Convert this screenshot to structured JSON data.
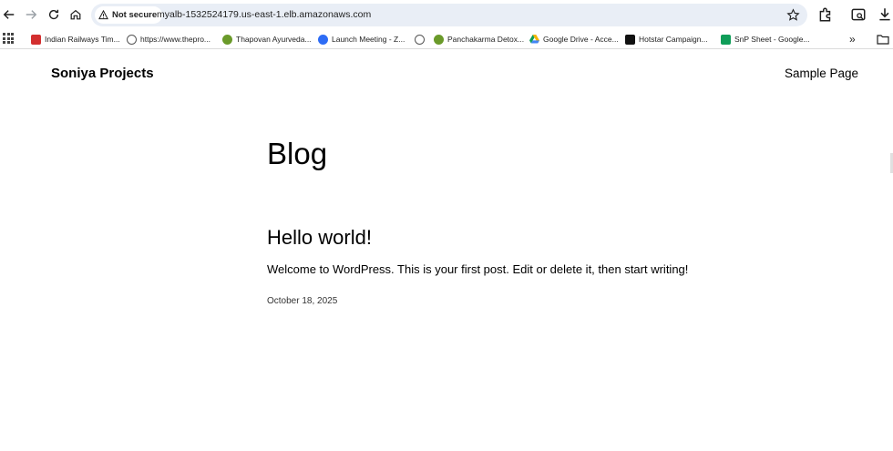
{
  "browser": {
    "security_label": "Not secure",
    "url": "myalb-1532524179.us-east-1.elb.amazonaws.com",
    "bookmarks": [
      {
        "label": "Indian Railways Tim...",
        "icon": "train-icon",
        "color": "#d32f2f"
      },
      {
        "label": "https://www.thepro...",
        "icon": "globe-icon",
        "color": "#555555"
      },
      {
        "label": "Thapovan Ayurveda...",
        "icon": "leaf-icon",
        "color": "#6a9a2a"
      },
      {
        "label": "Launch Meeting - Z...",
        "icon": "zoom-icon",
        "color": "#2d6cf5"
      },
      {
        "label": "",
        "icon": "globe-icon",
        "color": "#555555"
      },
      {
        "label": "Panchakarma Detox...",
        "icon": "leaf-icon",
        "color": "#6a9a2a"
      },
      {
        "label": "Google Drive - Acce...",
        "icon": "drive-icon",
        "color": "#f4b400"
      },
      {
        "label": "Hotstar Campaign...",
        "icon": "hotstar-icon",
        "color": "#111111"
      },
      {
        "label": "SnP Sheet - Google...",
        "icon": "sheets-icon",
        "color": "#0f9d58"
      }
    ]
  },
  "site": {
    "title": "Soniya Projects",
    "nav_link": "Sample Page"
  },
  "main": {
    "heading": "Blog",
    "post": {
      "title": "Hello world!",
      "excerpt": "Welcome to WordPress. This is your first post. Edit or delete it, then start writing!",
      "date": "October 18, 2025"
    }
  }
}
